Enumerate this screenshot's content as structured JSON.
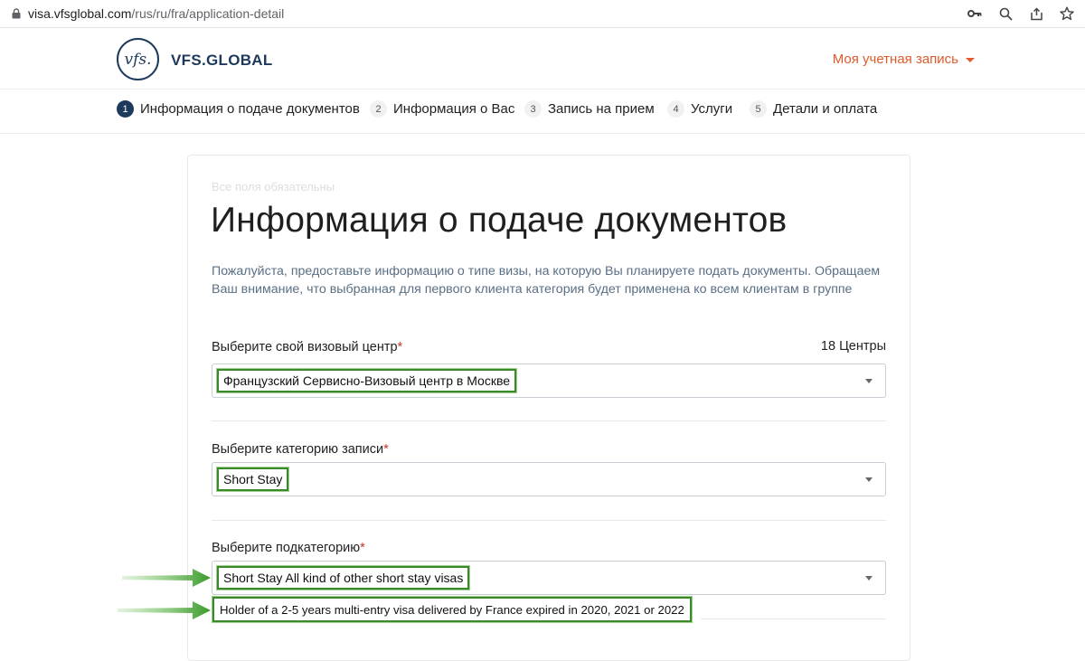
{
  "browser": {
    "url_host": "visa.vfsglobal.com",
    "url_path": "/rus/ru/fra/application-detail"
  },
  "header": {
    "logo_mark": "vfs.",
    "logo_text": "VFS.GLOBAL",
    "account_label": "Моя учетная запись"
  },
  "steps": [
    {
      "num": "1",
      "label": "Информация о подаче документов"
    },
    {
      "num": "2",
      "label": "Информация о Вас"
    },
    {
      "num": "3",
      "label": "Запись на прием"
    },
    {
      "num": "4",
      "label": "Услуги"
    },
    {
      "num": "5",
      "label": "Детали и оплата"
    }
  ],
  "form": {
    "required_note": "Все поля обязательны",
    "title": "Информация о подаче документов",
    "description": "Пожалуйста, предоставьте информацию о типе визы, на которую Вы планируете подать документы. Обращаем Ваш внимание, что выбранная для первого клиента категория будет применена ко всем клиентам в группе",
    "centre": {
      "label": "Выберите свой визовый центр",
      "count": "18 Центры",
      "value": "Французский Сервисно-Визовый центр в Москве"
    },
    "category": {
      "label": "Выберите категорию записи",
      "value": "Short Stay"
    },
    "subcategory": {
      "label": "Выберите подкатегорию",
      "value": "Short Stay All kind of other short stay visas",
      "option_hint": "Holder of a 2-5 years multi-entry visa delivered by France expired in 2020, 2021 or 2022"
    },
    "required_mark": "*"
  },
  "colors": {
    "brand": "#1d3a5c",
    "accent": "#e05a2b",
    "highlight": "#3a8a2a"
  }
}
